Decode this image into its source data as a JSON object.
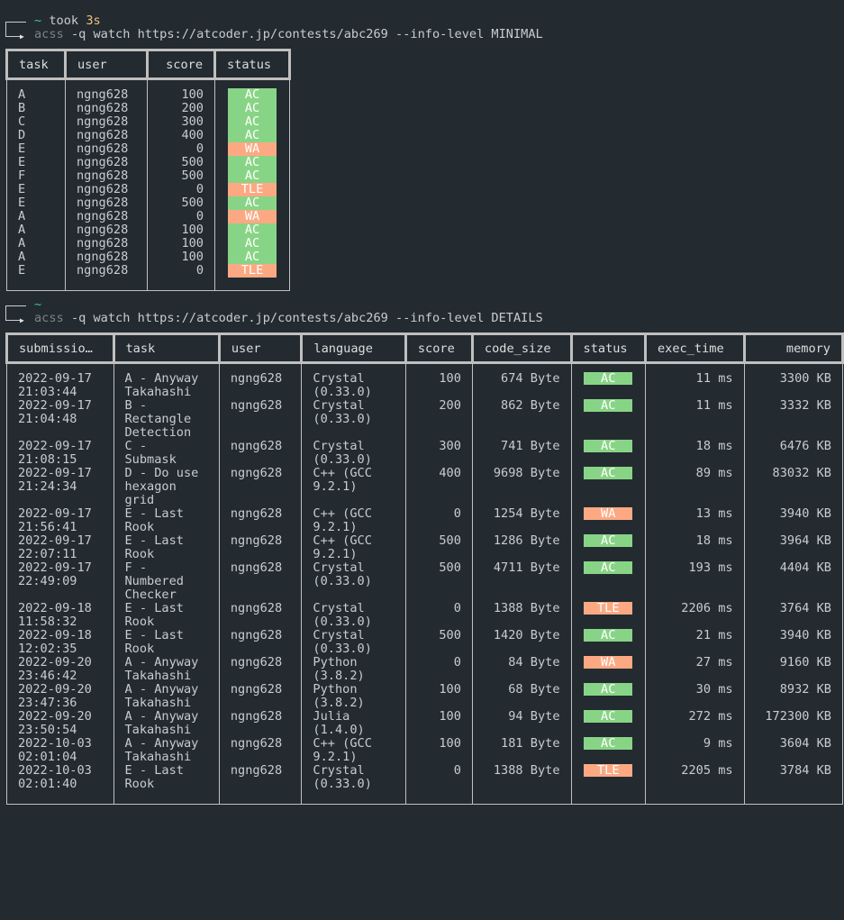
{
  "prompt1": {
    "tilde": "~",
    "took_label": "took",
    "took_value": "3s",
    "exe": "acss",
    "args": "-q watch https://atcoder.jp/contests/abc269 --info-level MINIMAL"
  },
  "minimal_table": {
    "headers": [
      "task",
      "user",
      "score",
      "status"
    ],
    "rows": [
      {
        "task": "A",
        "user": "ngng628",
        "score": "100",
        "status": "AC"
      },
      {
        "task": "B",
        "user": "ngng628",
        "score": "200",
        "status": "AC"
      },
      {
        "task": "C",
        "user": "ngng628",
        "score": "300",
        "status": "AC"
      },
      {
        "task": "D",
        "user": "ngng628",
        "score": "400",
        "status": "AC"
      },
      {
        "task": "E",
        "user": "ngng628",
        "score": "0",
        "status": "WA"
      },
      {
        "task": "E",
        "user": "ngng628",
        "score": "500",
        "status": "AC"
      },
      {
        "task": "F",
        "user": "ngng628",
        "score": "500",
        "status": "AC"
      },
      {
        "task": "E",
        "user": "ngng628",
        "score": "0",
        "status": "TLE"
      },
      {
        "task": "E",
        "user": "ngng628",
        "score": "500",
        "status": "AC"
      },
      {
        "task": "A",
        "user": "ngng628",
        "score": "0",
        "status": "WA"
      },
      {
        "task": "A",
        "user": "ngng628",
        "score": "100",
        "status": "AC"
      },
      {
        "task": "A",
        "user": "ngng628",
        "score": "100",
        "status": "AC"
      },
      {
        "task": "A",
        "user": "ngng628",
        "score": "100",
        "status": "AC"
      },
      {
        "task": "E",
        "user": "ngng628",
        "score": "0",
        "status": "TLE"
      }
    ]
  },
  "prompt2": {
    "tilde": "~",
    "exe": "acss",
    "args": "-q watch https://atcoder.jp/contests/abc269 --info-level DETAILS"
  },
  "details_table": {
    "headers": [
      "submissio…",
      "task",
      "user",
      "language",
      "score",
      "code_size",
      "status",
      "exec_time",
      "memory"
    ],
    "rows": [
      {
        "submission": "2022-09-17\n21:03:44",
        "task": "A - Anyway\nTakahashi",
        "user": "ngng628",
        "language": "Crystal\n(0.33.0)",
        "score": "100",
        "code_size": "674 Byte",
        "status": "AC",
        "exec_time": "11 ms",
        "memory": "3300 KB"
      },
      {
        "submission": "2022-09-17\n21:04:48",
        "task": "B -\nRectangle\nDetection",
        "user": "ngng628",
        "language": "Crystal\n(0.33.0)",
        "score": "200",
        "code_size": "862 Byte",
        "status": "AC",
        "exec_time": "11 ms",
        "memory": "3332 KB"
      },
      {
        "submission": "2022-09-17\n21:08:15",
        "task": "C -\nSubmask",
        "user": "ngng628",
        "language": "Crystal\n(0.33.0)",
        "score": "300",
        "code_size": "741 Byte",
        "status": "AC",
        "exec_time": "18 ms",
        "memory": "6476 KB"
      },
      {
        "submission": "2022-09-17\n21:24:34",
        "task": "D - Do use\nhexagon\ngrid",
        "user": "ngng628",
        "language": "C++ (GCC\n9.2.1)",
        "score": "400",
        "code_size": "9698 Byte",
        "status": "AC",
        "exec_time": "89 ms",
        "memory": "83032 KB"
      },
      {
        "submission": "2022-09-17\n21:56:41",
        "task": "E - Last\nRook",
        "user": "ngng628",
        "language": "C++ (GCC\n9.2.1)",
        "score": "0",
        "code_size": "1254 Byte",
        "status": "WA",
        "exec_time": "13 ms",
        "memory": "3940 KB"
      },
      {
        "submission": "2022-09-17\n22:07:11",
        "task": "E - Last\nRook",
        "user": "ngng628",
        "language": "C++ (GCC\n9.2.1)",
        "score": "500",
        "code_size": "1286 Byte",
        "status": "AC",
        "exec_time": "18 ms",
        "memory": "3964 KB"
      },
      {
        "submission": "2022-09-17\n22:49:09",
        "task": "F -\nNumbered\nChecker",
        "user": "ngng628",
        "language": "Crystal\n(0.33.0)",
        "score": "500",
        "code_size": "4711 Byte",
        "status": "AC",
        "exec_time": "193 ms",
        "memory": "4404 KB"
      },
      {
        "submission": "2022-09-18\n11:58:32",
        "task": "E - Last\nRook",
        "user": "ngng628",
        "language": "Crystal\n(0.33.0)",
        "score": "0",
        "code_size": "1388 Byte",
        "status": "TLE",
        "exec_time": "2206 ms",
        "memory": "3764 KB"
      },
      {
        "submission": "2022-09-18\n12:02:35",
        "task": "E - Last\nRook",
        "user": "ngng628",
        "language": "Crystal\n(0.33.0)",
        "score": "500",
        "code_size": "1420 Byte",
        "status": "AC",
        "exec_time": "21 ms",
        "memory": "3940 KB"
      },
      {
        "submission": "2022-09-20\n23:46:42",
        "task": "A - Anyway\nTakahashi",
        "user": "ngng628",
        "language": "Python\n(3.8.2)",
        "score": "0",
        "code_size": "84 Byte",
        "status": "WA",
        "exec_time": "27 ms",
        "memory": "9160 KB"
      },
      {
        "submission": "2022-09-20\n23:47:36",
        "task": "A - Anyway\nTakahashi",
        "user": "ngng628",
        "language": "Python\n(3.8.2)",
        "score": "100",
        "code_size": "68 Byte",
        "status": "AC",
        "exec_time": "30 ms",
        "memory": "8932 KB"
      },
      {
        "submission": "2022-09-20\n23:50:54",
        "task": "A - Anyway\nTakahashi",
        "user": "ngng628",
        "language": "Julia\n(1.4.0)",
        "score": "100",
        "code_size": "94 Byte",
        "status": "AC",
        "exec_time": "272 ms",
        "memory": "172300 KB"
      },
      {
        "submission": "2022-10-03\n02:01:04",
        "task": "A - Anyway\nTakahashi",
        "user": "ngng628",
        "language": "C++ (GCC\n9.2.1)",
        "score": "100",
        "code_size": "181 Byte",
        "status": "AC",
        "exec_time": "9 ms",
        "memory": "3604 KB"
      },
      {
        "submission": "2022-10-03\n02:01:40",
        "task": "E - Last\nRook",
        "user": "ngng628",
        "language": "Crystal\n(0.33.0)",
        "score": "0",
        "code_size": "1388 Byte",
        "status": "TLE",
        "exec_time": "2205 ms",
        "memory": "3784 KB"
      }
    ]
  },
  "colors": {
    "background": "#232b30",
    "text": "#c9ccce",
    "accent_tilde": "#3cc5a2",
    "took_value": "#f0c27b",
    "status_ac": "#88d486",
    "status_wa": "#fca983",
    "status_tle": "#fca983"
  }
}
